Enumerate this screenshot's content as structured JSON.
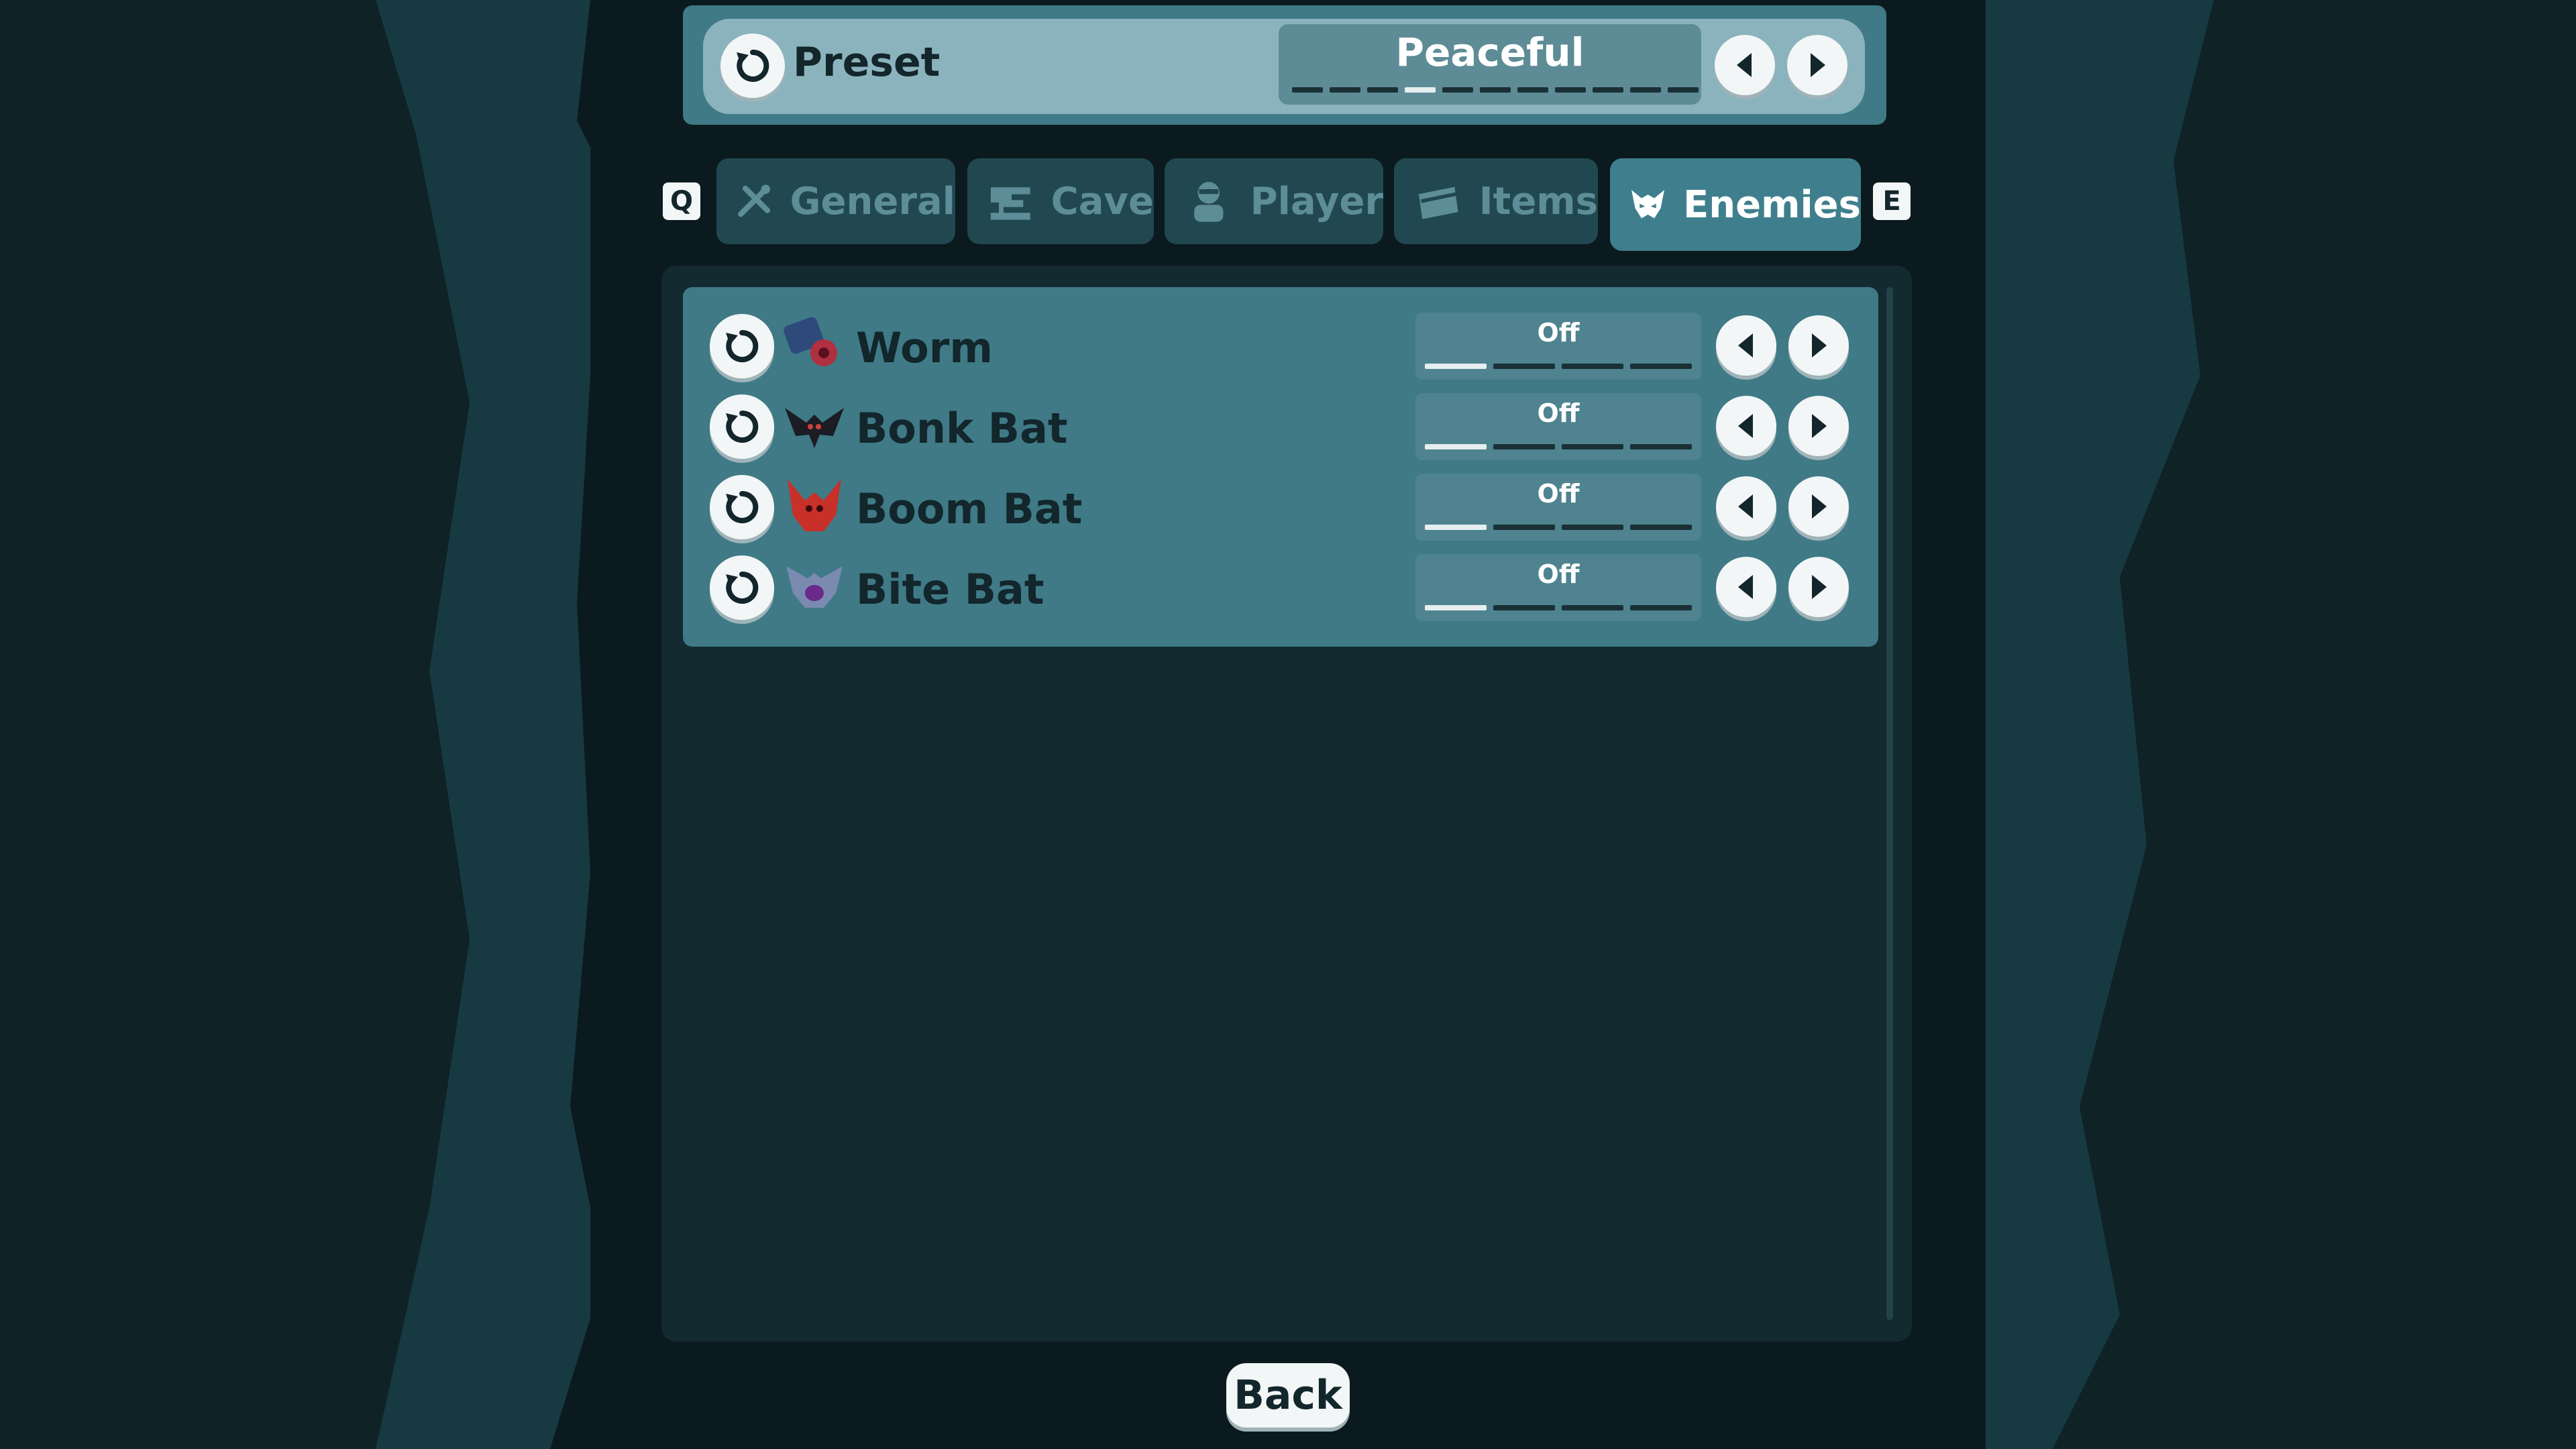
{
  "preset": {
    "label": "Preset",
    "value": "Peaceful",
    "level_index": 3,
    "level_count": 11
  },
  "tabs": {
    "prev_key": "Q",
    "next_key": "E",
    "items": [
      {
        "label": "General",
        "icon": "wrench-screwdriver-icon",
        "active": false
      },
      {
        "label": "Cave",
        "icon": "cave-icon",
        "active": false
      },
      {
        "label": "Player",
        "icon": "player-icon",
        "active": false
      },
      {
        "label": "Items",
        "icon": "items-icon",
        "active": false
      },
      {
        "label": "Enemies",
        "icon": "enemy-mask-icon",
        "active": true
      }
    ]
  },
  "enemies": [
    {
      "name": "Worm",
      "icon": "worm-icon",
      "value": "Off",
      "level_index": 0,
      "level_count": 4
    },
    {
      "name": "Bonk Bat",
      "icon": "bonk-bat-icon",
      "value": "Off",
      "level_index": 0,
      "level_count": 4
    },
    {
      "name": "Boom Bat",
      "icon": "boom-bat-icon",
      "value": "Off",
      "level_index": 0,
      "level_count": 4
    },
    {
      "name": "Bite Bat",
      "icon": "bite-bat-icon",
      "value": "Off",
      "level_index": 0,
      "level_count": 4
    }
  ],
  "back_label": "Back",
  "colors": {
    "accent": "#3f7a86",
    "active_tab": "#3f7f8d",
    "button": "#f3f6f6",
    "background": "#0b1a1e"
  }
}
